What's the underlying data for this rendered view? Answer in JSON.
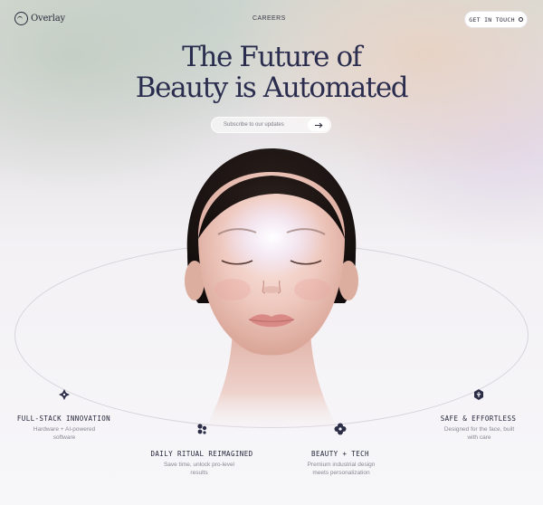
{
  "header": {
    "logo_text": "Overlay",
    "nav_link": "CAREERS",
    "cta_label": "GET IN TOUCH"
  },
  "hero": {
    "title_line1": "The Future of",
    "title_line2": "Beauty is Automated"
  },
  "subscribe": {
    "placeholder": "Subscribe to our updates",
    "button_icon": "arrow-right-icon"
  },
  "features": [
    {
      "icon": "sparkle-cross-icon",
      "title": "FULL-STACK INNOVATION",
      "desc": "Hardware + AI-powered software"
    },
    {
      "icon": "dots-cluster-icon",
      "title": "DAILY RITUAL REIMAGINED",
      "desc": "Save time, unlock pro-level results"
    },
    {
      "icon": "flower-icon",
      "title": "BEAUTY + TECH",
      "desc": "Premium industrial design meets personalization"
    },
    {
      "icon": "shield-leaf-icon",
      "title": "SAFE & EFFORTLESS",
      "desc": "Designed for the face, built with care"
    }
  ],
  "colors": {
    "ink": "#2a2d4e",
    "muted": "#8a8894",
    "ellipse": "#d7d4dc"
  }
}
